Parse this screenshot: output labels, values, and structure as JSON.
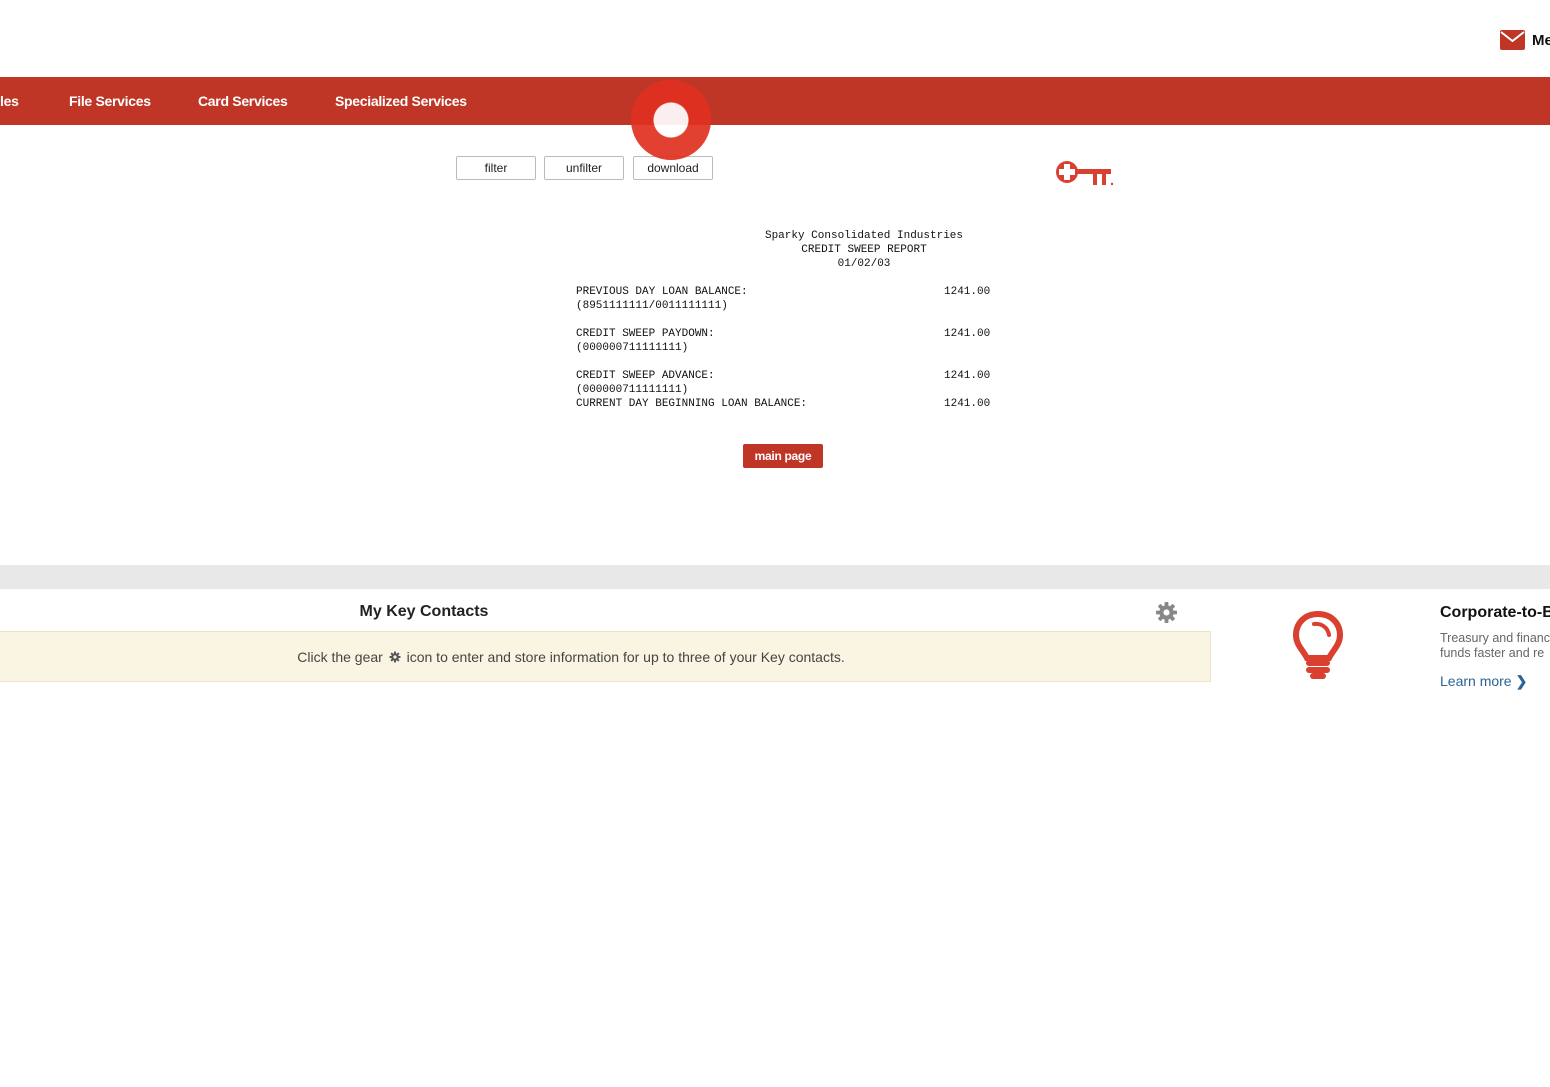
{
  "header": {
    "message_label": "Me"
  },
  "nav": {
    "items": [
      {
        "label": "les"
      },
      {
        "label": "File Services"
      },
      {
        "label": "Card Services"
      },
      {
        "label": "Specialized Services"
      }
    ]
  },
  "toolbar": {
    "filter": "filter",
    "unfilter": "unfilter",
    "download": "download"
  },
  "report": {
    "company": "Sparky Consolidated Industries",
    "title": "CREDIT SWEEP REPORT",
    "date": "01/02/03",
    "rows": [
      {
        "label": "PREVIOUS DAY LOAN BALANCE:",
        "sub": "(8951111111/0011111111)",
        "value": "1241.00"
      },
      {
        "label": "CREDIT SWEEP PAYDOWN:",
        "sub": "(000000711111111)",
        "value": "1241.00"
      },
      {
        "label": "CREDIT SWEEP ADVANCE:",
        "sub": "(000000711111111)",
        "value": "1241.00"
      },
      {
        "label": "CURRENT DAY BEGINNING LOAN BALANCE:",
        "sub": "",
        "value": "1241.00"
      }
    ],
    "main_page_button": "main page"
  },
  "key_contacts": {
    "title": "My Key Contacts",
    "text_before": "Click the gear",
    "text_after": "icon to enter and store information for up to three of your Key contacts."
  },
  "promo": {
    "title": "Corporate-to-B",
    "desc_line1": "Treasury and financ",
    "desc_line2": "funds faster and re",
    "link": "Learn more"
  },
  "colors": {
    "brand_red": "#bf3627",
    "notice_bg": "#faf4e2",
    "link_blue": "#2a6496"
  },
  "icons": [
    "envelope-icon",
    "key-logo-icon",
    "gear-icon",
    "lightbulb-icon",
    "chevron-right-icon"
  ]
}
